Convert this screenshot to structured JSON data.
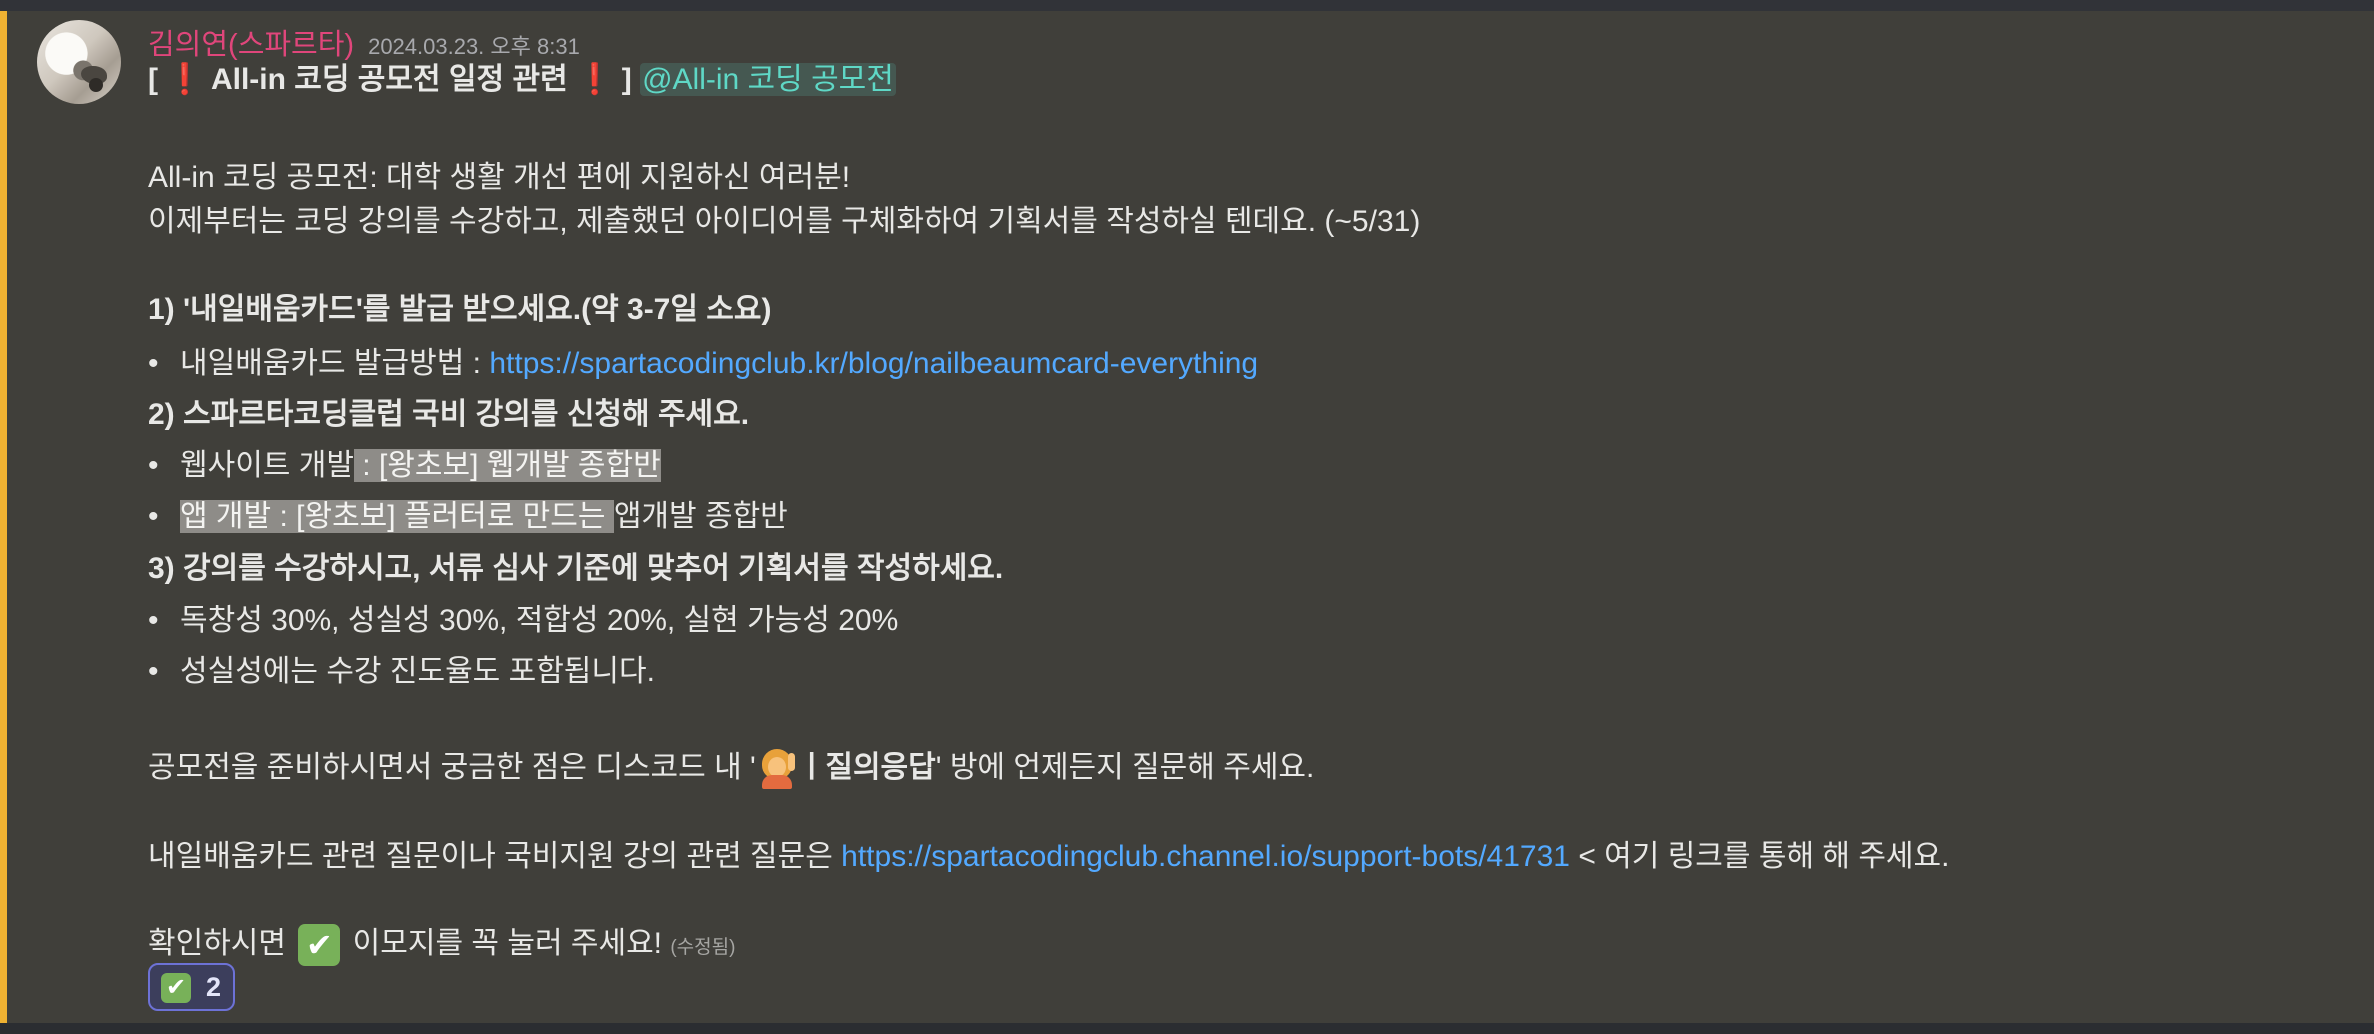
{
  "message": {
    "author": "김의연(스파르타)",
    "timestamp": "2024.03.23. 오후 8:31",
    "title": {
      "bracket_open": "[",
      "exclam": "❗",
      "text": "All-in 코딩 공모전 일정 관련",
      "bracket_close": "]",
      "mention": "@All-in 코딩 공모전"
    },
    "intro_1": "All-in 코딩 공모전: 대학 생활 개선 편에 지원하신 여러분!",
    "intro_2": "이제부터는 코딩 강의를 수강하고, 제출했던 아이디어를 구체화하여 기획서를 작성하실 텐데요. (~5/31)",
    "step1": {
      "heading": "1) '내일배움카드'를 발급 받으세요.(약 3-7일 소요)",
      "bullet_label": "내일배움카드 발급방법 : ",
      "bullet_link": "https://spartacodingclub.kr/blog/nailbeaumcard-everything"
    },
    "step2": {
      "heading": "2) 스파르타코딩클럽 국비 강의를 신청해 주세요.",
      "bullet1_a": "웹사이트 개발",
      "bullet1_b": " :  [왕초보] 웹개발 종합반",
      "bullet2_a": "앱 개발 : [왕초보] 플러터로 만드는 ",
      "bullet2_b": "앱개발 종합반"
    },
    "step3": {
      "heading": "3) 강의를 수강하시고, 서류 심사 기준에 맞추어 기획서를 작성하세요.",
      "bullet1": "독창성 30%, 성실성 30%, 적합성 20%, 실현 가능성 20%",
      "bullet2": "성실성에는 수강 진도율도 포함됩니다."
    },
    "qa_line": {
      "before": "공모전을 준비하시면서 궁금한 점은 디스코드 내 '",
      "channel": "ㅣ질의응답",
      "after": "' 방에 언제든지 질문해 주세요."
    },
    "support_line": {
      "before": "내일배움카드 관련 질문이나 국비지원 강의 관련 질문은 ",
      "link": "https://spartacodingclub.channel.io/support-bots/41731",
      "after": " < 여기 링크를 통해 해 주세요."
    },
    "confirm_line": {
      "before": "확인하시면 ",
      "after": " 이모지를 꼭 눌러 주세요! ",
      "edited": "(수정됨)"
    },
    "reaction": {
      "emoji": "✔",
      "count": "2"
    },
    "bullet_char": "•",
    "check_char": "✔",
    "accent_color": "#f0b232",
    "author_color": "#e0467b",
    "link_color": "#53a9ff",
    "mention_color": "#5fd8c6"
  }
}
